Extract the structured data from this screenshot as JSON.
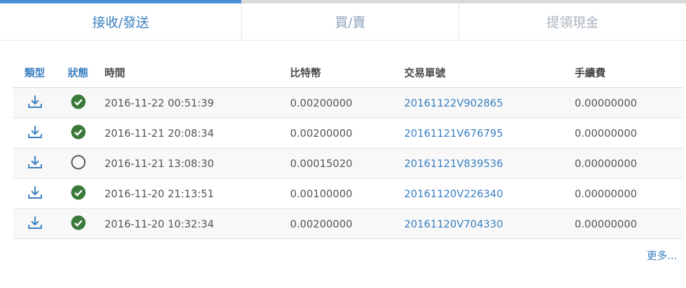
{
  "tabs": [
    {
      "label": "接收/發送"
    },
    {
      "label": "買/賣"
    },
    {
      "label": "提領現金"
    }
  ],
  "table": {
    "headers": {
      "type": "類型",
      "status": "狀態",
      "time": "時間",
      "btc": "比特幣",
      "tx": "交易單號",
      "fee": "手續費"
    },
    "rows": [
      {
        "icon": "download-icon",
        "status": "check-circle-icon",
        "time": "2016-11-22 00:51:39",
        "btc": "0.00200000",
        "tx": "20161122V902865",
        "fee": "0.00000000"
      },
      {
        "icon": "download-icon",
        "status": "check-circle-icon",
        "time": "2016-11-21 20:08:34",
        "btc": "0.00200000",
        "tx": "20161121V676795",
        "fee": "0.00000000"
      },
      {
        "icon": "download-icon",
        "status": "pending-circle-icon",
        "time": "2016-11-21 13:08:30",
        "btc": "0.00015020",
        "tx": "20161121V839536",
        "fee": "0.00000000"
      },
      {
        "icon": "download-icon",
        "status": "check-circle-icon",
        "time": "2016-11-20 21:13:51",
        "btc": "0.00100000",
        "tx": "20161120V226340",
        "fee": "0.00000000"
      },
      {
        "icon": "download-icon",
        "status": "check-circle-icon",
        "time": "2016-11-20 10:32:34",
        "btc": "0.00200000",
        "tx": "20161120V704330",
        "fee": "0.00000000"
      }
    ]
  },
  "more_label": "更多...",
  "colors": {
    "accent": "#3a7fc1",
    "success": "#3b7a3b"
  }
}
